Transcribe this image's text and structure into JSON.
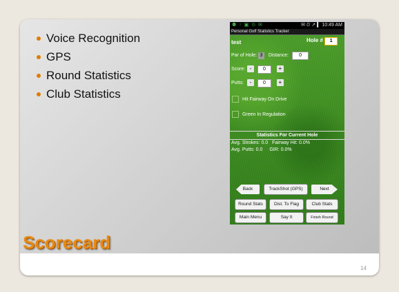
{
  "slide": {
    "bullets": [
      "Voice Recognition",
      "GPS",
      "Round Statistics",
      "Club Statistics"
    ],
    "title": "Scorecard",
    "page_number": "14"
  },
  "phone": {
    "status_icons": "⚉ ↑ ▣ ⊙ ✉",
    "status_right": "✉ ⏲ ↗ ▍ 10:49 AM",
    "app_title": "Personal Golf Statistics Tracker",
    "player": "test",
    "hole_label": "Hole #",
    "hole_value": "1",
    "par_label": "Par of Hole:",
    "par_value": "3",
    "distance_label": "Distance:",
    "distance_value": "0",
    "score_label": "Score:",
    "score_value": "0",
    "putts_label": "Putts:",
    "putts_value": "0",
    "minus": "-",
    "plus": "+",
    "hit_fairway": "Hit Fairway On Drive",
    "green_regulation": "Green In Regulation",
    "stats_heading": "Statistics For Current Hole",
    "avg_strokes": "Avg. Strokes: 0.0",
    "fairway_hit": "Fairway Hit: 0.0%",
    "avg_putts": "Avg. Putts: 0.0",
    "gir": "GIR: 0.0%",
    "buttons": {
      "back": "Back",
      "trackshot": "TrackShot (GPS)",
      "next": "Next",
      "round_stats": "Round Stats",
      "dist_flag": "Dist. To Flag",
      "club_stats": "Club Stats",
      "main_menu": "Main Menu",
      "say_it": "Say It",
      "finish_round": "Finish Round"
    }
  }
}
